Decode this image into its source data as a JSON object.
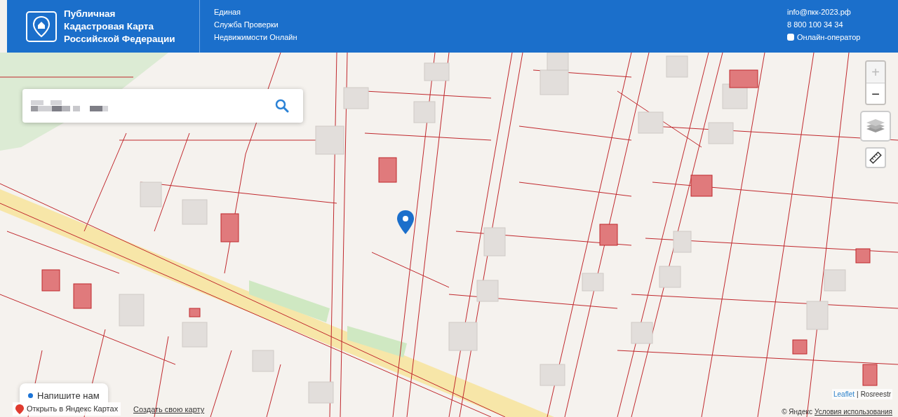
{
  "header": {
    "title_lines": [
      "Публичная",
      "Кадастровая Карта",
      "Российской Федерации"
    ],
    "subtitle_lines": [
      "Единая",
      "Служба Проверки",
      "Недвижимости Онлайн"
    ],
    "email": "info@пкк-2023.рф",
    "phone": "8 800 100 34 34",
    "operator_link": "Онлайн-оператор"
  },
  "search": {
    "value_redacted": true
  },
  "map_controls": [
    {
      "kind": "zoom",
      "label": "+",
      "disabled": true
    },
    {
      "kind": "zoom",
      "label": "−",
      "disabled": false
    },
    {
      "kind": "layers"
    },
    {
      "kind": "ruler"
    }
  ],
  "chat_button": {
    "label": "Напишите нам"
  },
  "footer": {
    "open_link": "Открыть в Яндекс Картах",
    "create_link": "Создать свою карту",
    "attribution_link": "Leaflet",
    "attribution_separator": "|",
    "attribution_source": "Rosreestr",
    "copyright": "© Яндекс",
    "terms_link": "Условия использования"
  }
}
